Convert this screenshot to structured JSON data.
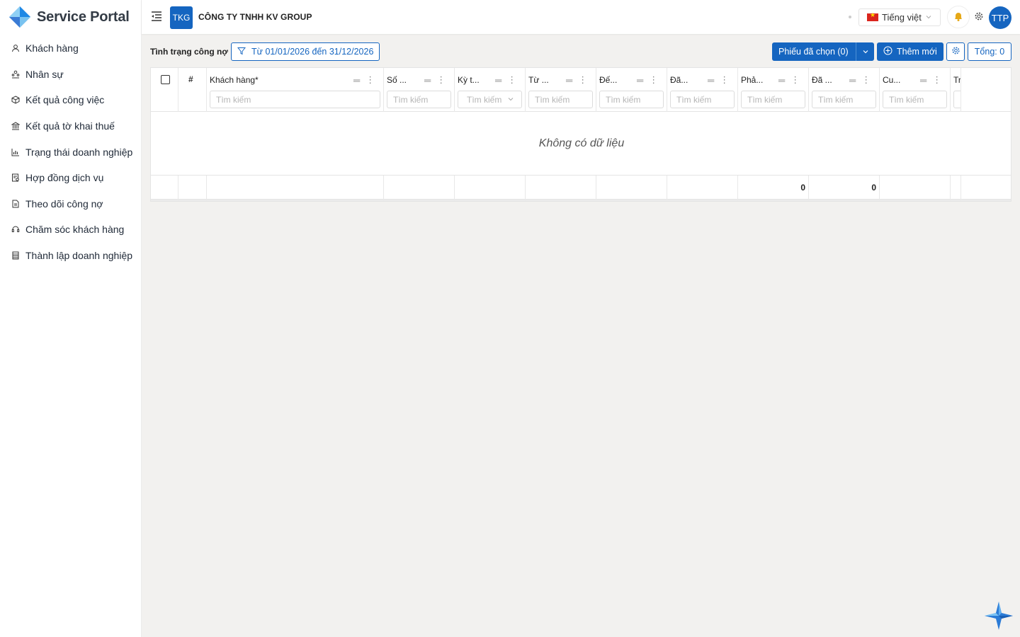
{
  "app": {
    "name": "Service Portal"
  },
  "sidebar": {
    "items": [
      {
        "label": "Khách hàng",
        "icon": "user-icon"
      },
      {
        "label": "Nhân sự",
        "icon": "team-icon"
      },
      {
        "label": "Kết quả công việc",
        "icon": "box-icon"
      },
      {
        "label": "Kết quả tờ khai thuế",
        "icon": "bank-icon"
      },
      {
        "label": "Trạng thái doanh nghiệp",
        "icon": "bar-chart-icon"
      },
      {
        "label": "Hợp đồng dịch vụ",
        "icon": "contract-icon"
      },
      {
        "label": "Theo dõi công nợ",
        "icon": "document-icon"
      },
      {
        "label": "Chăm sóc khách hàng",
        "icon": "support-icon"
      },
      {
        "label": "Thành lập doanh nghiệp",
        "icon": "building-icon"
      }
    ]
  },
  "header": {
    "company_badge": "TKG",
    "company_name": "CÔNG TY TNHH KV GROUP",
    "language": "Tiếng việt",
    "avatar": "TTP"
  },
  "toolbar": {
    "label": "Tình trạng công nợ",
    "date_filter": "Từ 01/01/2026 đến 31/12/2026",
    "selected_button": "Phiếu đã chọn (0)",
    "add_button": "Thêm mới",
    "total": "Tổng: 0"
  },
  "grid": {
    "columns": [
      {
        "title": "Khách hàng*",
        "placeholder": "Tìm kiếm"
      },
      {
        "title": "Số ...",
        "placeholder": "Tìm kiếm"
      },
      {
        "title": "Kỳ t...",
        "placeholder": "Tìm kiếm"
      },
      {
        "title": "Từ ...",
        "placeholder": "Tìm kiếm"
      },
      {
        "title": "Đế...",
        "placeholder": "Tìm kiếm"
      },
      {
        "title": "Đã...",
        "placeholder": "Tìm kiếm"
      },
      {
        "title": "Phả...",
        "placeholder": "Tìm kiếm"
      },
      {
        "title": "Đã ...",
        "placeholder": "Tìm kiếm"
      },
      {
        "title": "Cu...",
        "placeholder": "Tìm kiếm"
      },
      {
        "title": "Tr",
        "placeholder": ""
      }
    ],
    "index_header": "#",
    "empty_text": "Không có dữ liệu",
    "footer_totals": {
      "col7": "0",
      "col8": "0"
    }
  },
  "colors": {
    "primary": "#1565c0",
    "background": "#f2f1ef"
  }
}
